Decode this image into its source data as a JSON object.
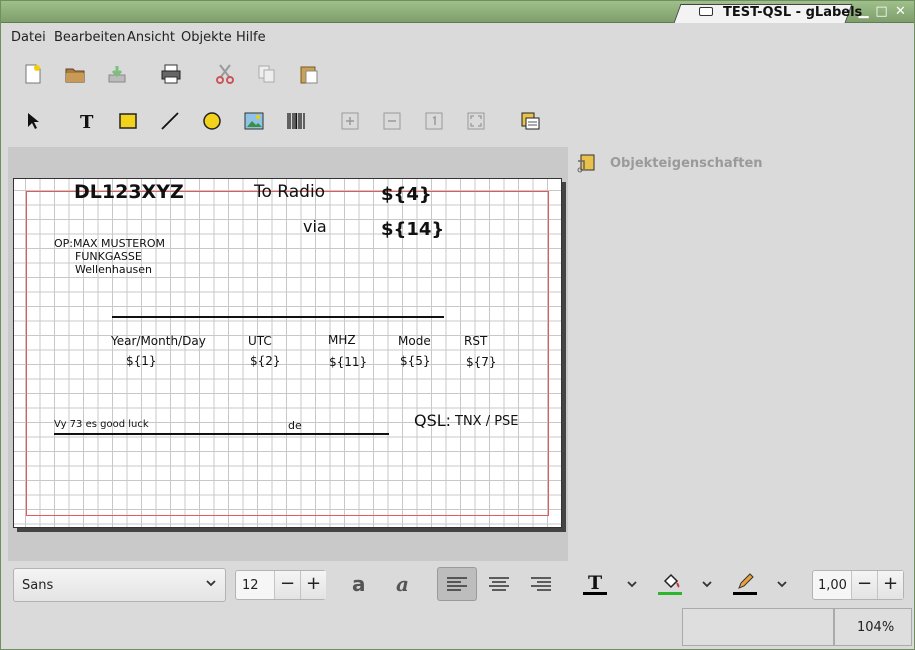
{
  "window": {
    "title": "TEST-QSL - gLabels",
    "min": "▁",
    "max": "□",
    "close": "✕"
  },
  "menu": [
    "Datei",
    "Bearbeiten",
    "Ansicht",
    "Objekte",
    "Hilfe"
  ],
  "toolbar_main": [
    "new-file-icon",
    "open-folder-icon",
    "save-icon",
    "print-icon",
    "cut-icon",
    "copy-icon",
    "paste-icon"
  ],
  "toolbar_tools": [
    "arrow-select-icon",
    "text-tool-icon",
    "box-tool-icon",
    "line-tool-icon",
    "ellipse-tool-icon",
    "image-tool-icon",
    "barcode-tool-icon",
    "zoom-in-icon",
    "zoom-out-icon",
    "zoom-one-icon",
    "zoom-fit-icon",
    "merge-properties-icon"
  ],
  "label": {
    "call": "DL123XYZ",
    "to_radio": "To Radio",
    "var4": "${4}",
    "via": "via",
    "var14": "${14}",
    "op_line1": "OP:MAX MUSTEROM",
    "op_line2": "FUNKGASSE",
    "op_line3": "Wellenhausen",
    "col_date": "Year/Month/Day",
    "col_utc": "UTC",
    "col_mhz": "MHZ",
    "col_mode": "Mode",
    "col_rst": "RST",
    "v1": "${1}",
    "v2": "${2}",
    "v11": "${11}",
    "v5": "${5}",
    "v7": "${7}",
    "vy73": "Vy 73 es good luck",
    "de": "de",
    "qsl": "QSL:",
    "tnx": "TNX / PSE"
  },
  "properties": {
    "title": "Objekteigenschaften"
  },
  "format": {
    "font": "Sans",
    "size": "12",
    "line_width": "1,00",
    "minus": "−",
    "plus": "+"
  },
  "status": {
    "zoom": "104%"
  },
  "colors": {
    "text_color": "#000000",
    "fill_color": "#2db52d",
    "line_color": "#000000"
  }
}
